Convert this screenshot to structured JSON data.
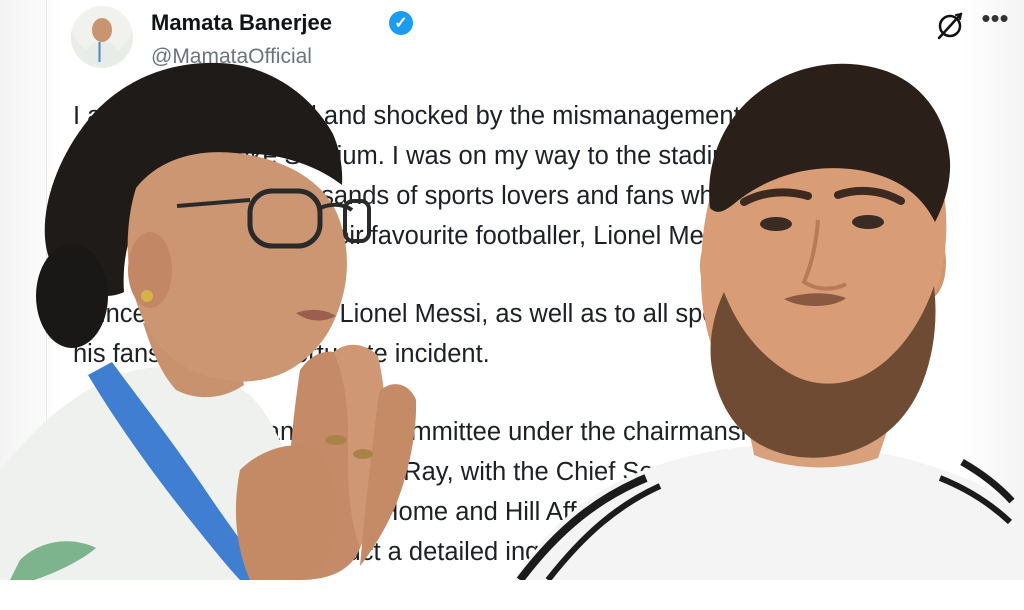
{
  "tweet": {
    "display_name": "Mamata Banerjee",
    "handle": "@MamataOfficial",
    "paragraphs": [
      "I am deeply disturbed and shocked by the mismanagement witnessed\ntoday at Salt Lake Stadium. I was on my way to the stadium to attend the\nevent, along with thousands of sports lovers and fans who had gathered\nto catch a glimpse of their favourite footballer, Lionel Messi.",
      "I sincerely apologise to Lionel Messi, as well as to all sports lovers and\nhis fans, for this unfortunate incident.",
      "I am constituting an inquiry committee under the chairmanship of\nJustice (Retd.) Ashim Kumar Ray, with the Chief Secretary and\nAdditional Chief Secretary, Home and Hill Affairs Department, as members.\nThe committee will conduct a detailed inquiry."
    ]
  },
  "icons": {
    "verified": "verified-badge-icon",
    "grok": "grok-icon",
    "more": "more-options-icon"
  },
  "colors": {
    "verified_badge": "#1d9bf0",
    "text_primary": "#1d2024",
    "text_secondary": "#6b747d",
    "saree_border": "#3f7ed0",
    "jersey": "#f4f4f4"
  },
  "photos": {
    "left": "Mamata Banerjee with folded hands",
    "right": "Lionel Messi in white jersey"
  }
}
